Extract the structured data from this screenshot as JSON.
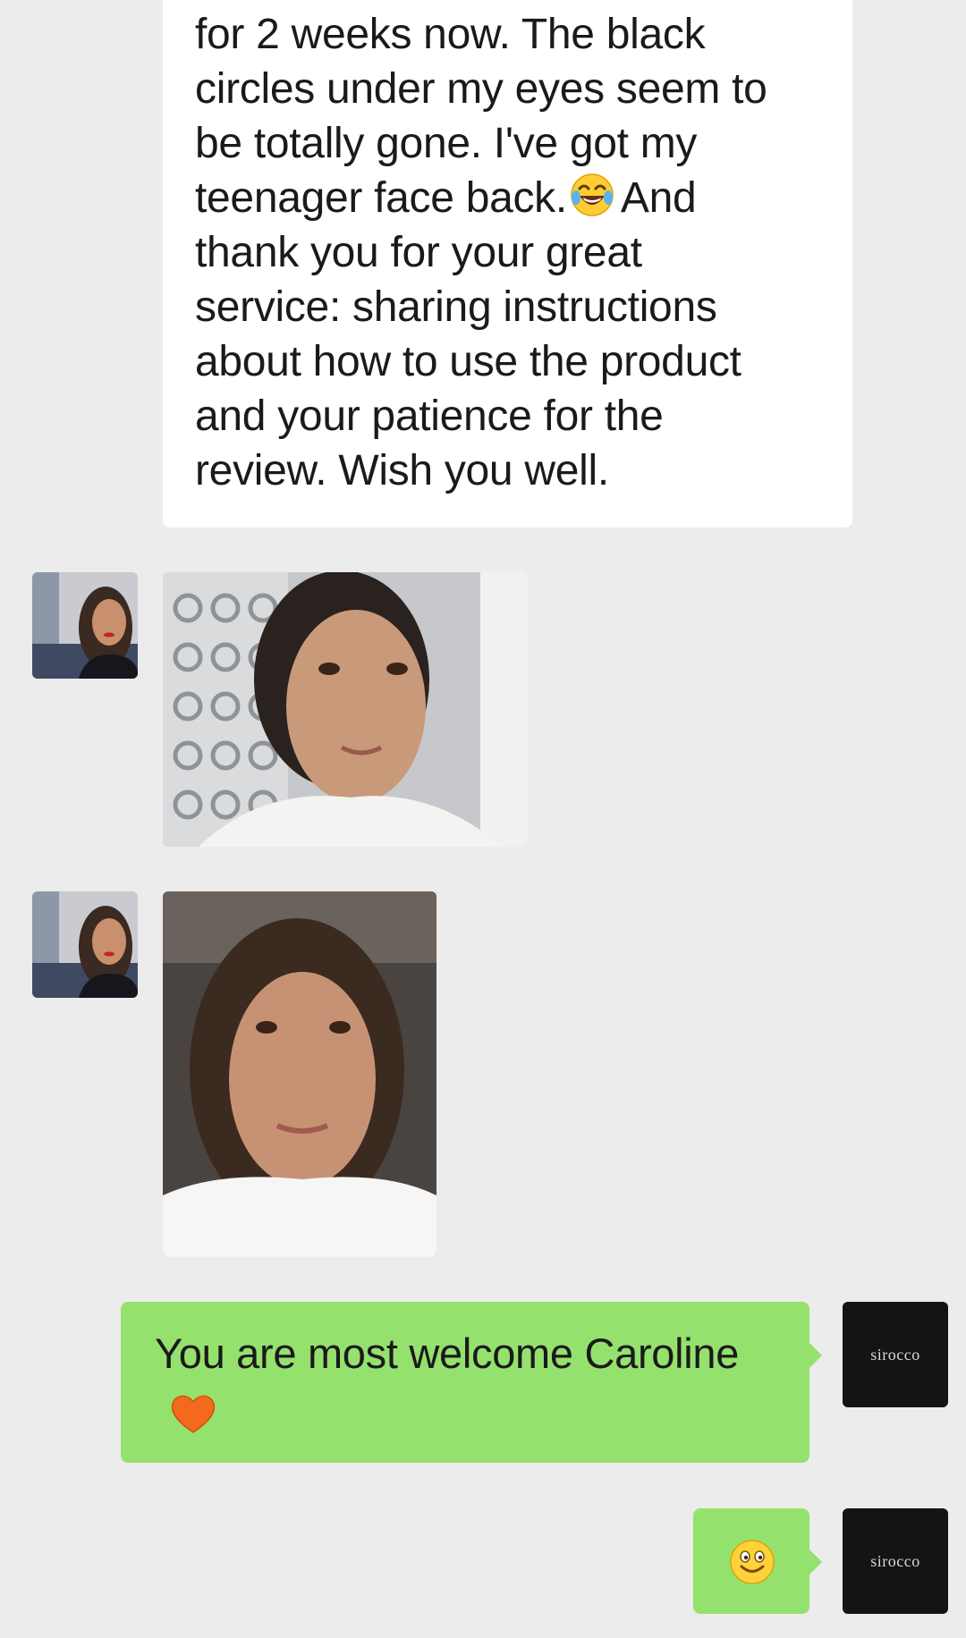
{
  "conversation": {
    "incoming_text": {
      "lines": [
        "for 2 weeks now. The black",
        "circles under my eyes seem to",
        "be totally gone. I've got my",
        "teenager face back.",
        "And",
        "thank you for your great",
        "service: sharing instructions",
        "about how to use the product",
        "and your patience for the",
        "review. Wish you well."
      ],
      "inline_emoji": "face-with-tears-of-joy"
    },
    "outgoing_reply": {
      "text": "You are most welcome Caroline",
      "emoji": "orange-heart"
    },
    "outgoing_emoji": "smiling-face",
    "sender_brand": "sirocco"
  },
  "colors": {
    "background": "#ececec",
    "incoming_bubble": "#ffffff",
    "outgoing_bubble": "#95e16e",
    "brand_avatar": "#141414"
  }
}
